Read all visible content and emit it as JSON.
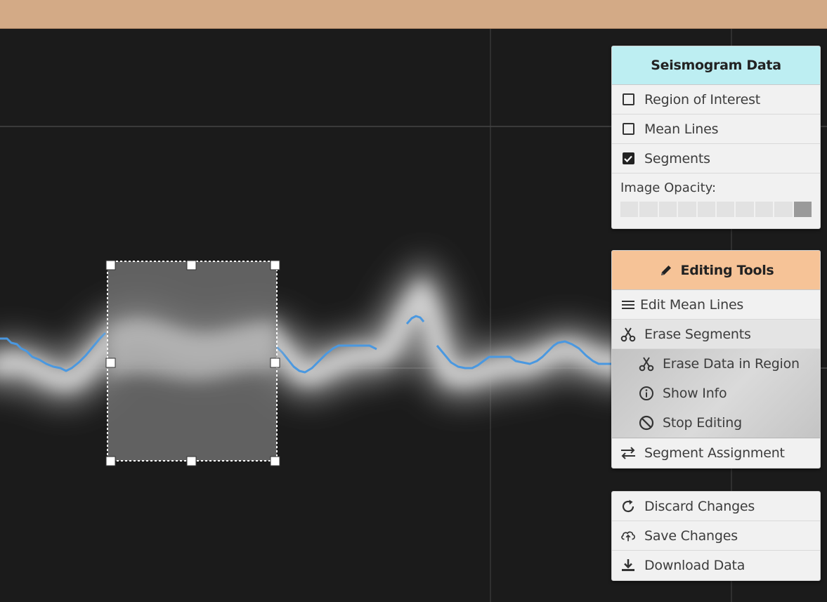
{
  "seismogram_panel": {
    "title": "Seismogram Data",
    "options": [
      {
        "label": "Region of Interest",
        "checked": false
      },
      {
        "label": "Mean Lines",
        "checked": false
      },
      {
        "label": "Segments",
        "checked": true
      }
    ],
    "opacity_label": "Image Opacity:",
    "opacity_level": 1.0
  },
  "editing_panel": {
    "title": "Editing Tools",
    "edit_mean_lines": "Edit Mean Lines",
    "erase_segments": "Erase Segments",
    "erase_data_in_region": "Erase Data in Region",
    "show_info": "Show Info",
    "stop_editing": "Stop Editing",
    "segment_assignment": "Segment Assignment"
  },
  "actions_panel": {
    "discard": "Discard Changes",
    "save": "Save Changes",
    "download": "Download Data"
  },
  "colors": {
    "topbar": "#d3aa86",
    "seismogram_header": "#bdeef2",
    "editing_header": "#f6c397",
    "trace": "#4a98e0"
  }
}
